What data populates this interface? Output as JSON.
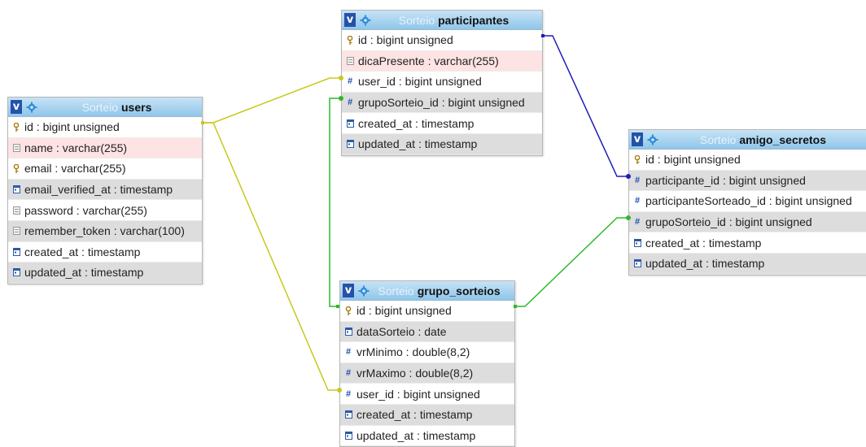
{
  "diagram": {
    "tables": [
      {
        "id": "users",
        "database": "Sorteio",
        "name": "users",
        "columns": [
          {
            "text": "id : bigint unsigned",
            "icon": "key-icon",
            "style": "plain"
          },
          {
            "text": "name : varchar(255)",
            "icon": "text-field-icon",
            "style": "highlight"
          },
          {
            "text": "email : varchar(255)",
            "icon": "key-icon",
            "style": "plain"
          },
          {
            "text": "email_verified_at : timestamp",
            "icon": "timestamp-icon",
            "style": "alt"
          },
          {
            "text": "password : varchar(255)",
            "icon": "text-field-icon",
            "style": "plain"
          },
          {
            "text": "remember_token : varchar(100)",
            "icon": "text-field-icon",
            "style": "alt"
          },
          {
            "text": "created_at : timestamp",
            "icon": "timestamp-icon",
            "style": "plain"
          },
          {
            "text": "updated_at : timestamp",
            "icon": "timestamp-icon",
            "style": "alt"
          }
        ]
      },
      {
        "id": "participantes",
        "database": "Sorteio",
        "name": "participantes",
        "columns": [
          {
            "text": "id : bigint unsigned",
            "icon": "key-icon",
            "style": "plain"
          },
          {
            "text": "dicaPresente : varchar(255)",
            "icon": "text-field-icon",
            "style": "highlight"
          },
          {
            "text": "user_id : bigint unsigned",
            "icon": "number-field-icon",
            "style": "plain"
          },
          {
            "text": "grupoSorteio_id : bigint unsigned",
            "icon": "number-field-icon",
            "style": "alt"
          },
          {
            "text": "created_at : timestamp",
            "icon": "timestamp-icon",
            "style": "plain"
          },
          {
            "text": "updated_at : timestamp",
            "icon": "timestamp-icon",
            "style": "alt"
          }
        ]
      },
      {
        "id": "grupo_sorteios",
        "database": "Sorteio",
        "name": "grupo_sorteios",
        "columns": [
          {
            "text": "id : bigint unsigned",
            "icon": "key-icon",
            "style": "plain"
          },
          {
            "text": "dataSorteio : date",
            "icon": "timestamp-icon",
            "style": "alt"
          },
          {
            "text": "vrMinimo : double(8,2)",
            "icon": "number-field-icon",
            "style": "plain"
          },
          {
            "text": "vrMaximo : double(8,2)",
            "icon": "number-field-icon",
            "style": "alt"
          },
          {
            "text": "user_id : bigint unsigned",
            "icon": "number-field-icon",
            "style": "plain"
          },
          {
            "text": "created_at : timestamp",
            "icon": "timestamp-icon",
            "style": "alt"
          },
          {
            "text": "updated_at : timestamp",
            "icon": "timestamp-icon",
            "style": "plain"
          }
        ]
      },
      {
        "id": "amigo_secretos",
        "database": "Sorteio",
        "name": "amigo_secretos",
        "columns": [
          {
            "text": "id : bigint unsigned",
            "icon": "key-icon",
            "style": "plain"
          },
          {
            "text": "participante_id : bigint unsigned",
            "icon": "number-field-icon",
            "style": "alt"
          },
          {
            "text": "participanteSorteado_id : bigint unsigned",
            "icon": "number-field-icon",
            "style": "plain"
          },
          {
            "text": "grupoSorteio_id : bigint unsigned",
            "icon": "number-field-icon",
            "style": "alt"
          },
          {
            "text": "created_at : timestamp",
            "icon": "timestamp-icon",
            "style": "plain"
          },
          {
            "text": "updated_at : timestamp",
            "icon": "timestamp-icon",
            "style": "alt"
          }
        ]
      }
    ],
    "relations": [
      {
        "name": "users-to-participantes",
        "color": "#c8c81e"
      },
      {
        "name": "users-to-grupo-sorteios",
        "color": "#c8c81e"
      },
      {
        "name": "grupo-sorteios-to-participantes",
        "color": "#2db82d"
      },
      {
        "name": "grupo-sorteios-to-amigo-secretos",
        "color": "#2db82d"
      },
      {
        "name": "participantes-to-amigo-secretos",
        "color": "#1e1eb4"
      }
    ]
  }
}
